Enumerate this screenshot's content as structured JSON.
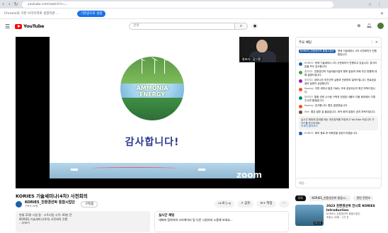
{
  "browser": {
    "address": "youtube.com/watch?v=...",
    "info_text": "Chrome의 기본 브라우저로 설정하면 ...",
    "info_button": "기본값으로 설정"
  },
  "masthead": {
    "logo_text": "YouTube",
    "search_placeholder": "검색"
  },
  "video": {
    "slide_title_line1": "AMMONIA",
    "slide_title_line2": "ENERGY",
    "slide_message": "감사합니다!",
    "webcam_label": "발표자 · 김ㅇ환",
    "zoom_watermark": "zoom"
  },
  "meta": {
    "title": "KORIES 기술세미나(4차) 사전회의",
    "channel_name": "KORIES_친환경선박 통합시업단",
    "channel_subs": "구독자 00명",
    "subscribe": "구독중",
    "like_count": "8",
    "share": "공유",
    "save": "저장",
    "more": "···"
  },
  "description": {
    "line1": "현재 23명 시청 중 · 스트리밍 시작: 00분 전",
    "line2": "KORIES 기술세미나(4차) 사전회의 진행",
    "line3": "...더보기"
  },
  "live_box": {
    "title": "실시간 채팅",
    "text": "대화에 참여하여 크리에이터 및 다른 시청자와 소통해 보세요..."
  },
  "chat": {
    "header": "주요 채팅",
    "pinned_channel": "KORIES_친환경선박 통합시업단",
    "pinned_text": "현재 기술세미나 4차 사전회의가 진행 중입니다.",
    "messages": [
      {
        "name": "KORIES",
        "text": "현재 기술세미나 4차 사전회의가 진행되고 있습니다. 참석자분들 모두 감사합니다.",
        "color": "#1f5fa8"
      },
      {
        "name": "참석자1",
        "text": "친환경선박 기술개발사업의 향후 일정과 과제 추진 방향에 대해 설명드립니다.",
        "color": "#43a047"
      },
      {
        "name": "참석자2",
        "text": "암모니아 추진선박 실증과 관련하여 질의드립니다. 연료공급 설비 일정이 궁금합니다.",
        "color": "#8e24aa"
      },
      {
        "name": "Kooboy",
        "text": "이번 세미나 발표 자료는 추후 공유되는지 확인 부탁드립니다.",
        "color": "#f4511e"
      },
      {
        "name": "참석자3",
        "text": "통합 관제 시스템 구축과 관련된 내용도 다음 회의에서 다뤄 주시면 좋겠습니다.",
        "color": "#00897b"
      },
      {
        "name": "Kooboy",
        "text": "감사합니다. 좋은 발표였습니다.",
        "color": "#f4511e"
      },
      {
        "name": "Mail",
        "text": "좋은 발표 잘 들었습니다. 후속 회의 일정도 공지 부탁드립니다.",
        "color": "#6d4c41"
      }
    ],
    "notice_text": "실시간 채팅에 참여할 때는 개인정보를 보호하고 YouTube 커뮤니티 가이드를 준수하세요.",
    "notice_link": "자세히 알아보기",
    "last_message": {
      "name": "KORIES",
      "text": "회의 종료 후 녹화본을 공유드리겠습니다.",
      "color": "#1f5fa8"
    },
    "input_placeholder": "채팅..."
  },
  "recommendations": {
    "tabs": [
      "모두",
      "KORIES_친환경선박 통합시...",
      "관련 콘텐츠"
    ],
    "item": {
      "title": "2023 친환경선박 전시회 KORIES Introduction",
      "channel": "KORIES_친환경선박 통합시업단",
      "stats": "조회수 00회 · 1년 전",
      "duration": "23:11"
    }
  }
}
